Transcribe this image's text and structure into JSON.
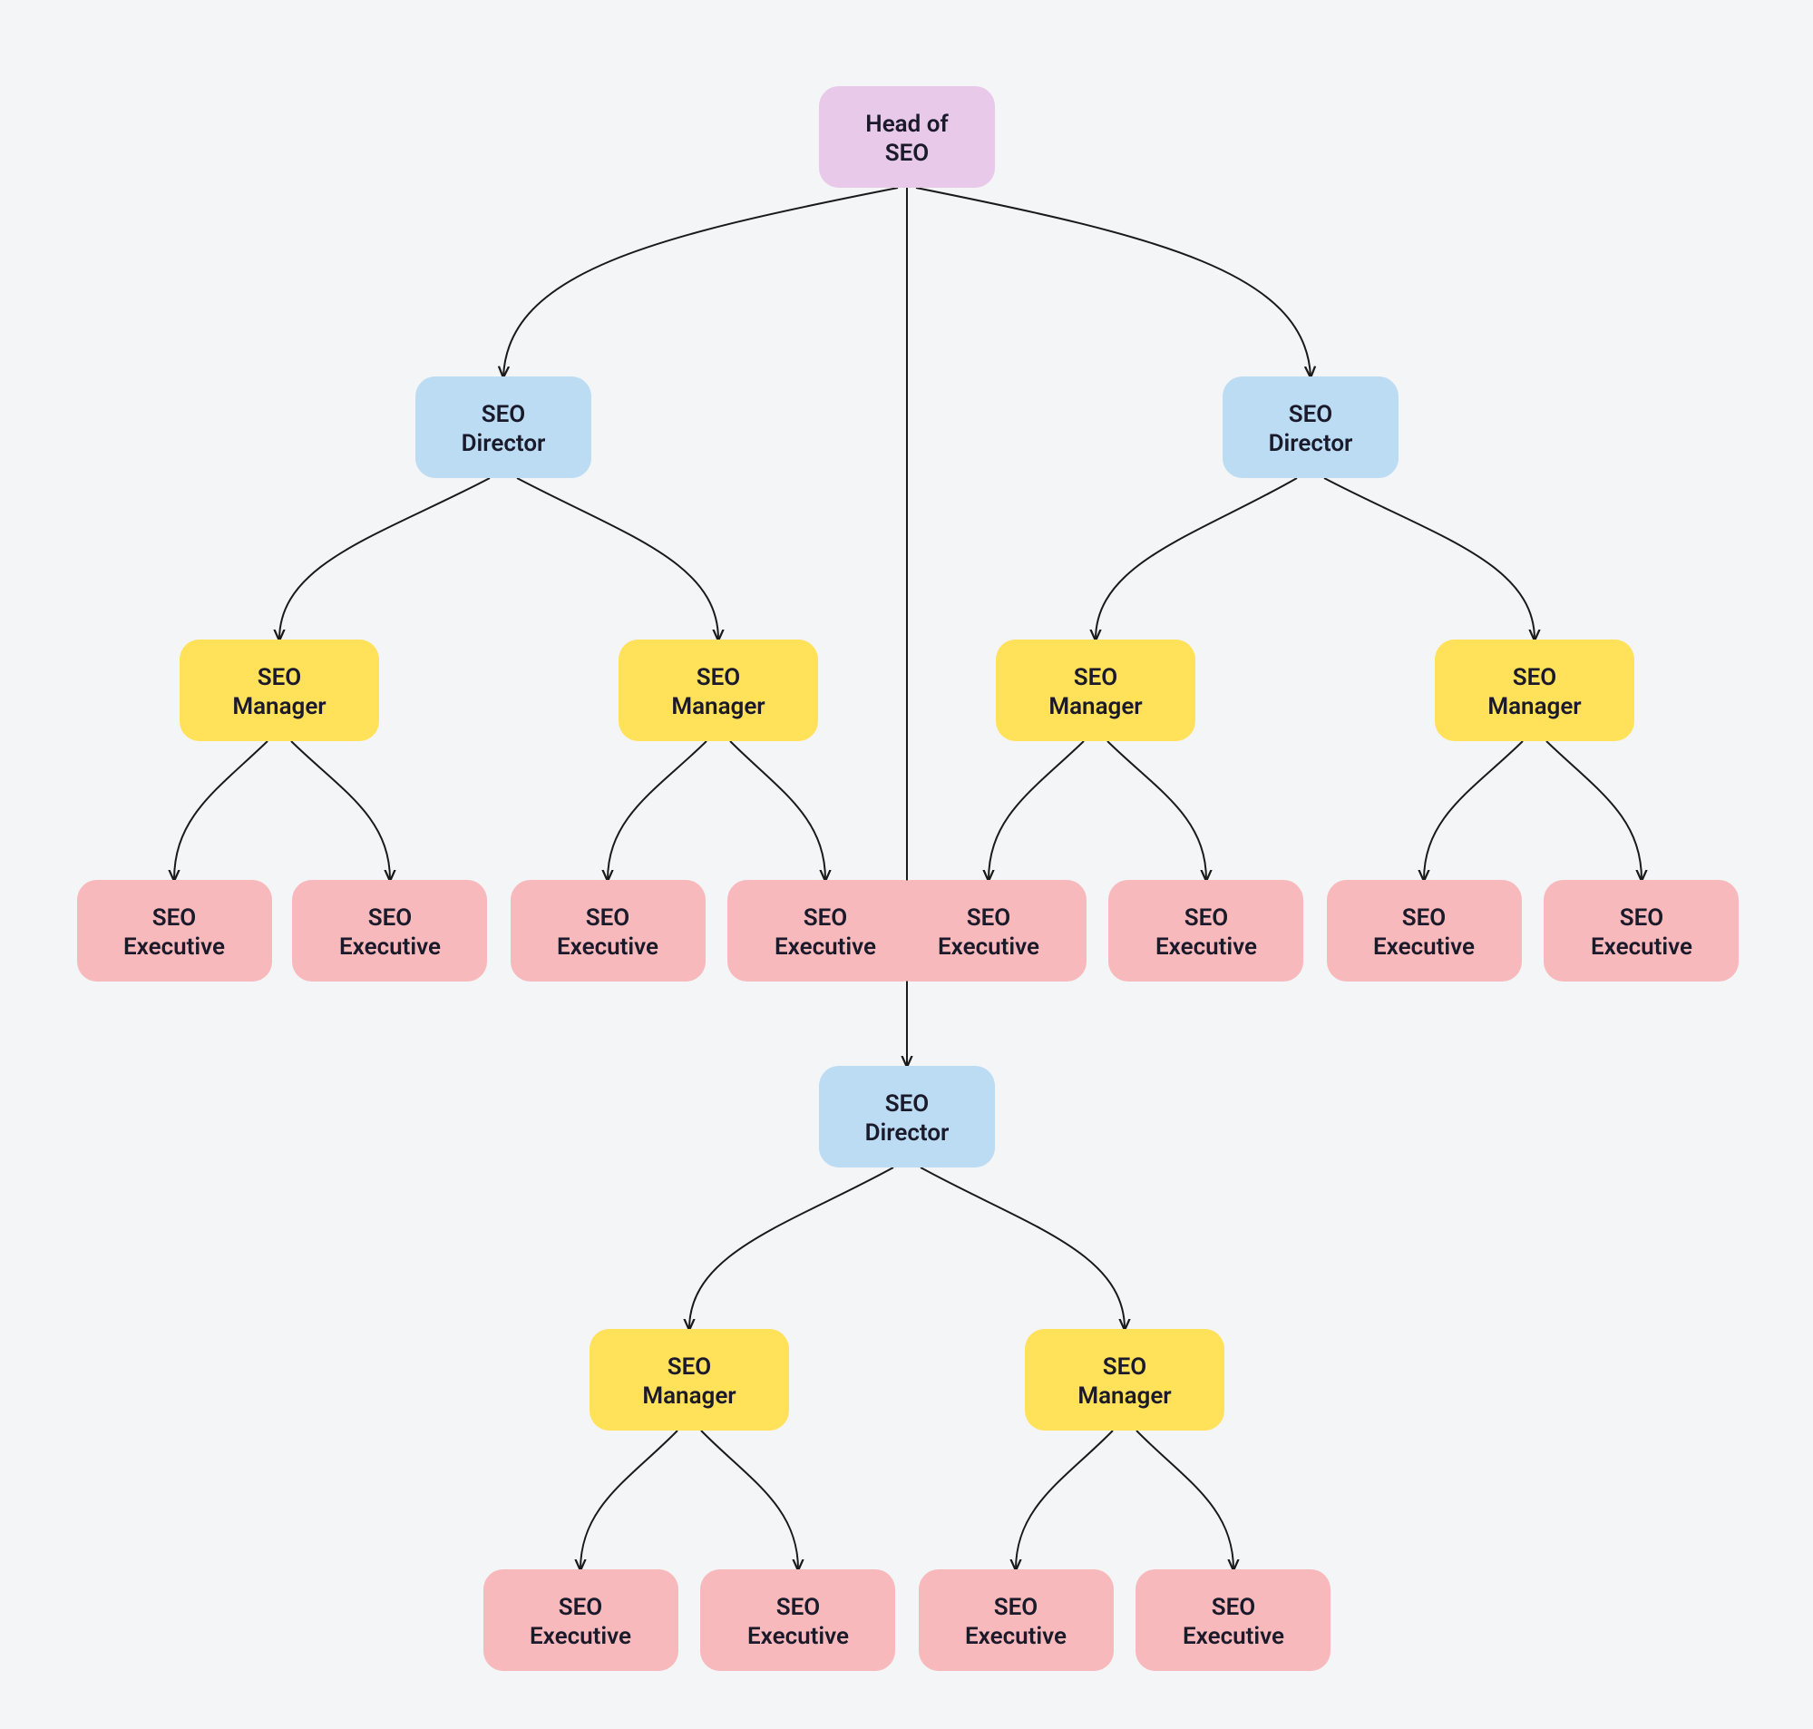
{
  "colors": {
    "root": "#e8c9ea",
    "director": "#bcdcf4",
    "manager": "#ffe15a",
    "executive": "#f8b9bc",
    "background": "#f4f5f6",
    "text": "#1a1a2a",
    "edge": "#1a1a1a"
  },
  "root": {
    "line1": "Head of",
    "line2": "SEO"
  },
  "director": {
    "line1": "SEO",
    "line2": "Director"
  },
  "manager": {
    "line1": "SEO",
    "line2": "Manager"
  },
  "executive": {
    "line1": "SEO",
    "line2": "Executive"
  },
  "chart_data": {
    "type": "tree",
    "title": "",
    "root": {
      "label": "Head of SEO",
      "children": [
        {
          "label": "SEO Director",
          "children": [
            {
              "label": "SEO Manager",
              "children": [
                {
                  "label": "SEO Executive"
                },
                {
                  "label": "SEO Executive"
                }
              ]
            },
            {
              "label": "SEO Manager",
              "children": [
                {
                  "label": "SEO Executive"
                },
                {
                  "label": "SEO Executive"
                }
              ]
            }
          ]
        },
        {
          "label": "SEO Director",
          "children": [
            {
              "label": "SEO Manager",
              "children": [
                {
                  "label": "SEO Executive"
                },
                {
                  "label": "SEO Executive"
                }
              ]
            },
            {
              "label": "SEO Manager",
              "children": [
                {
                  "label": "SEO Executive"
                },
                {
                  "label": "SEO Executive"
                }
              ]
            }
          ]
        },
        {
          "label": "SEO Director",
          "children": [
            {
              "label": "SEO Manager",
              "children": [
                {
                  "label": "SEO Executive"
                },
                {
                  "label": "SEO Executive"
                }
              ]
            },
            {
              "label": "SEO Manager",
              "children": [
                {
                  "label": "SEO Executive"
                },
                {
                  "label": "SEO Executive"
                }
              ]
            }
          ]
        }
      ]
    }
  }
}
